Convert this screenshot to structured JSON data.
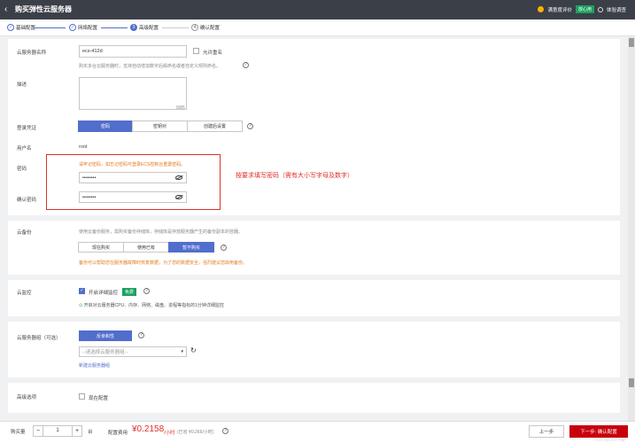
{
  "topbar": {
    "title": "购买弹性云服务器",
    "feedback": "满意度评价",
    "badge": "放心用",
    "experience": "体验调查"
  },
  "steps": [
    {
      "index": "✓",
      "label": "基础配置",
      "state": "done"
    },
    {
      "index": "✓",
      "label": "网络配置",
      "state": "done"
    },
    {
      "index": "3",
      "label": "高级配置",
      "state": "active"
    },
    {
      "index": "4",
      "label": "确认配置",
      "state": "todo"
    }
  ],
  "server_name": {
    "label": "云服务器名称",
    "value": "ecs-412d",
    "allow_duplicate": "允许重名",
    "hint": "购买多台云服务器时，支持自动增加数字后缀命名或者自定义规则命名。"
  },
  "description": {
    "label": "描述",
    "counter": "0/85"
  },
  "login": {
    "label": "登录凭证",
    "options": [
      "密码",
      "密钥对",
      "创建后设置"
    ],
    "username_label": "用户名",
    "username": "root",
    "password_label": "密码",
    "password_warning": "请牢记密码，如忘记密码可登录ECS控制台重置密码。",
    "password_value": "••••••••",
    "confirm_label": "确认密码",
    "confirm_value": "••••••••",
    "annotation": "按要求填写密码（需有大小写字母及数字）"
  },
  "backup": {
    "label": "云备份",
    "hint": "使用云备份服务，需购买备份存储库，存储库是存放服务器产生的备份副本的容器。",
    "options": [
      "现在购买",
      "使用已有",
      "暂不购买"
    ],
    "warning": "备份可以帮助您在服务器故障时恢复数据，为了您的数据安全，强烈建议您启用备份。"
  },
  "monitor": {
    "label": "云监控",
    "option": "开启详细监控",
    "free": "免费",
    "note": "开启对云服务器CPU、内存、网络、磁盘、进程等指标的1分钟详细监控"
  },
  "server_group": {
    "label": "云服务器组（可选）",
    "button": "反亲和性",
    "placeholder": "--请选择云服务器组--",
    "link": "新建云服务器组"
  },
  "advanced": {
    "label": "高级选项",
    "option": "现在配置"
  },
  "footer": {
    "qty_label": "购买量",
    "qty": "1",
    "unit": "台",
    "fee_label": "配置费用",
    "price": "¥0.2158",
    "price_unit": "/小时",
    "price_note": "(已省 ¥0.266/小时)",
    "prev": "上一步",
    "next": "下一步: 确认配置",
    "watermark": "CSDN @ivan小书童"
  },
  "colors": {
    "accent": "#526ecc",
    "warn": "#e37b1f",
    "red": "#e0302a",
    "green": "#1ba15f"
  }
}
